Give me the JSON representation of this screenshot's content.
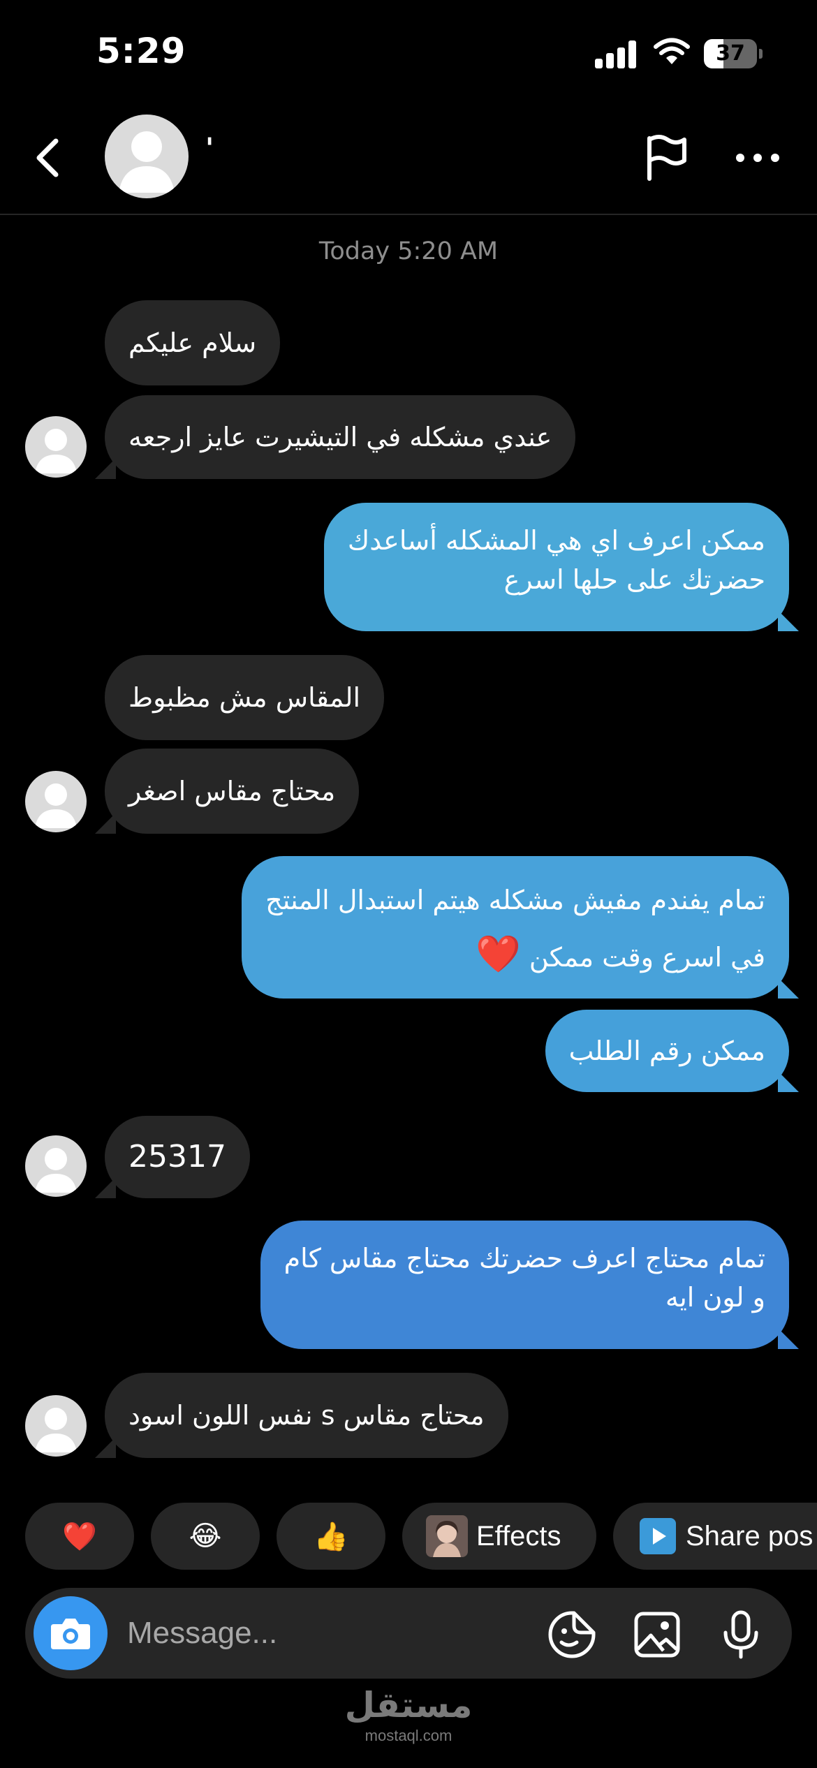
{
  "status": {
    "time": "5:29",
    "battery": "37",
    "battery_level": 0.37
  },
  "header": {
    "contact_name": "'"
  },
  "chat": {
    "timestamp": "Today 5:20 AM"
  },
  "messages": [
    {
      "text": "سلام عليكم"
    },
    {
      "text": "عندي مشكله في التيشيرت عايز ارجعه"
    },
    {
      "line1": "ممكن اعرف اي هي المشكله  أساعدك",
      "line2": "حضرتك  على حلها اسرع"
    },
    {
      "text": "المقاس مش مظبوط"
    },
    {
      "text": "محتاج مقاس اصغر"
    },
    {
      "line1": "تمام يفندم مفيش مشكله هيتم استبدال المنتج",
      "line2": "في اسرع وقت ممكن",
      "emoji": "❤️"
    },
    {
      "text": "ممكن رقم الطلب"
    },
    {
      "text": "25317"
    },
    {
      "line1": "تمام محتاج اعرف حضرتك محتاج مقاس كام",
      "line2": "و لون ايه"
    },
    {
      "text": "محتاج مقاس s  نفس اللون اسود"
    }
  ],
  "quick_reactions": {
    "heart": "❤️",
    "laugh": "😂",
    "thumbs_up": "👍",
    "effects_label": "Effects",
    "share_label": "Share pos"
  },
  "composer": {
    "placeholder": "Message..."
  },
  "watermark": {
    "arabic": "مستقل",
    "latin": "mostaql.com"
  },
  "colors": {
    "background": "#000000",
    "incoming_bubble": "#262626",
    "outgoing_bubble_top": "#4aa8d8",
    "outgoing_bubble_bottom": "#3f86d6",
    "camera_button": "#3797f0",
    "timestamp": "#8e8e8e"
  }
}
